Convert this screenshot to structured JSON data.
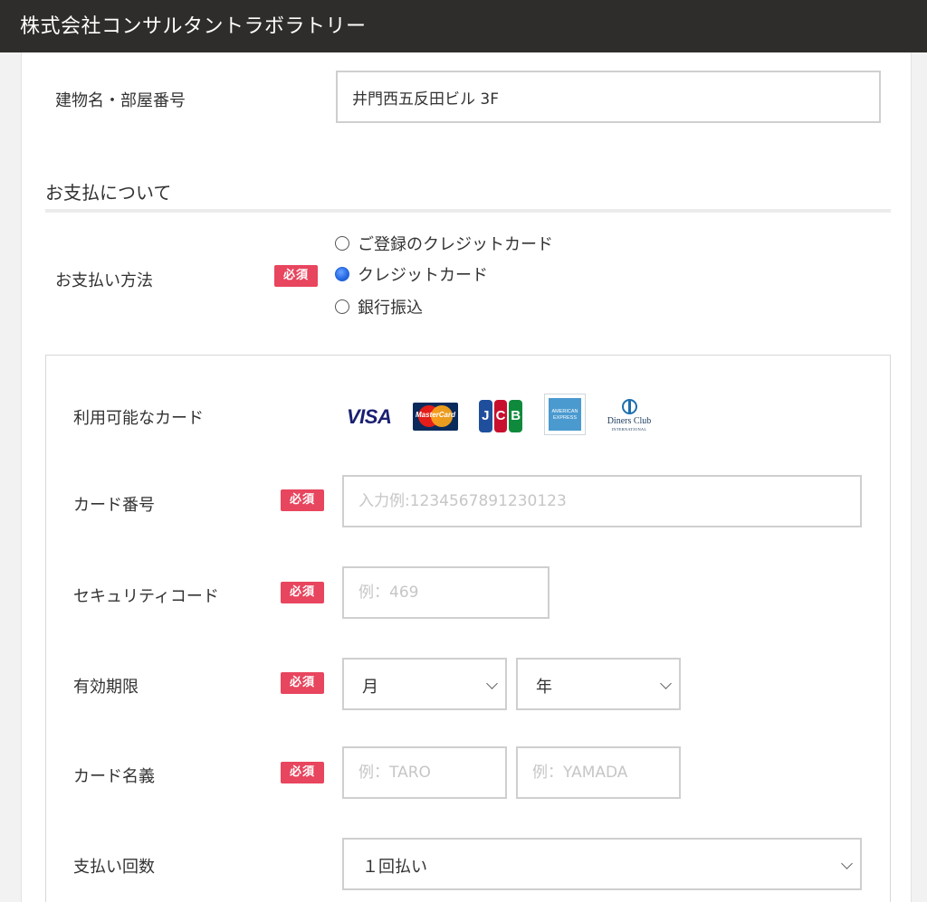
{
  "header": {
    "title": "株式会社コンサルタントラボラトリー"
  },
  "address": {
    "building_label": "建物名・部屋番号",
    "building_value": "井門西五反田ビル 3F"
  },
  "payment": {
    "section_title": "お支払について",
    "method_label": "お支払い方法",
    "required_badge": "必須",
    "options": [
      {
        "label": "ご登録のクレジットカード",
        "checked": false
      },
      {
        "label": "クレジットカード",
        "checked": true
      },
      {
        "label": "銀行振込",
        "checked": false
      }
    ]
  },
  "card_form": {
    "available_label": "利用可能なカード",
    "logos": {
      "visa": "VISA",
      "mastercard": "MasterCard",
      "jcb_letters": [
        "J",
        "C",
        "B"
      ],
      "jcb_colors": [
        "#1f4f9c",
        "#c8102e",
        "#0f8a3c"
      ],
      "amex_lines": [
        "AMERICAN",
        "EXPRESS"
      ],
      "diners_name": "Diners Club",
      "diners_sub": "INTERNATIONAL"
    },
    "card_number": {
      "label": "カード番号",
      "placeholder": "入力例:1234567891230123"
    },
    "security_code": {
      "label": "セキュリティコード",
      "placeholder": "例：469"
    },
    "expiry": {
      "label": "有効期限",
      "month_value": "月",
      "year_value": "年"
    },
    "card_name": {
      "label": "カード名義",
      "first_placeholder": "例：TARO",
      "last_placeholder": "例：YAMADA"
    },
    "installments": {
      "label": "支払い回数",
      "value": "１回払い"
    }
  },
  "colors": {
    "header_bg": "#2f2d2b",
    "required_badge": "#e8455e",
    "radio_checked": "#2a6ee8",
    "visa_text": "#1a1f71"
  }
}
